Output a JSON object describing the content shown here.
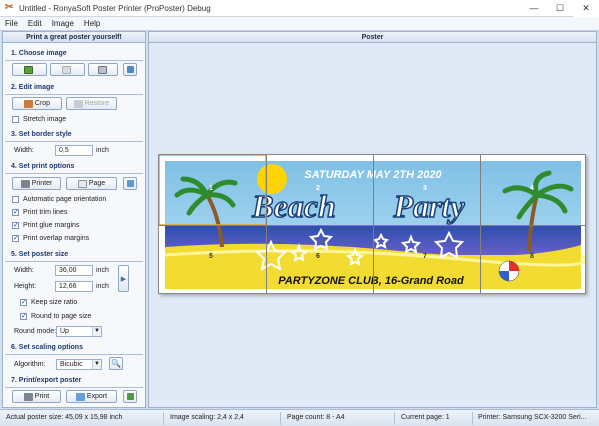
{
  "window": {
    "title": "Untitled - RonyaSoft Poster Printer (ProPoster) Debug"
  },
  "menu": [
    "File",
    "Edit",
    "Image",
    "Help"
  ],
  "left_panel": {
    "header": "Print a great poster yourself!",
    "s1": {
      "title": "1. Choose image"
    },
    "s2": {
      "title": "2. Edit image",
      "crop": "Crop",
      "restore": "Restore",
      "stretch": "Stretch image"
    },
    "s3": {
      "title": "3. Set border style",
      "width_label": "Width:",
      "width_value": "0,5",
      "unit": "inch"
    },
    "s4": {
      "title": "4. Set print options",
      "printer": "Printer",
      "page": "Page",
      "auto_orient": "Automatic page orientation",
      "trim": "Print trim lines",
      "glue": "Print glue margins",
      "overlap": "Print overlap margins"
    },
    "s5": {
      "title": "5. Set poster size",
      "width_label": "Width:",
      "width_value": "36,00",
      "height_label": "Height:",
      "height_value": "12,66",
      "unit": "inch",
      "keep": "Keep size ratio",
      "round": "Round to page size",
      "round_mode_label": "Round mode:",
      "round_mode_value": "Up"
    },
    "s6": {
      "title": "6. Set scaling options",
      "algorithm_label": "Algorithm:",
      "algorithm_value": "Bicubic"
    },
    "s7": {
      "title": "7. Print/export poster",
      "print": "Print",
      "export": "Export"
    }
  },
  "right_panel": {
    "header": "Poster"
  },
  "poster": {
    "date_text": "SATURDAY MAY 2TH 2020",
    "headline_1": "Beach",
    "headline_2": "Party",
    "footer_text": "PARTYZONE CLUB, 16-Grand Road",
    "page_numbers": [
      "1",
      "2",
      "3",
      "4",
      "5",
      "6",
      "7",
      "8"
    ]
  },
  "status": {
    "size": "Actual poster size: 45,09 x 15,98 inch",
    "scaling": "Image scaling: 2,4 x 2,4",
    "pages": "Page count: 8 - A4",
    "current": "Current page: 1",
    "printer": "Printer: Samsung SCX-3200 Seri..."
  }
}
